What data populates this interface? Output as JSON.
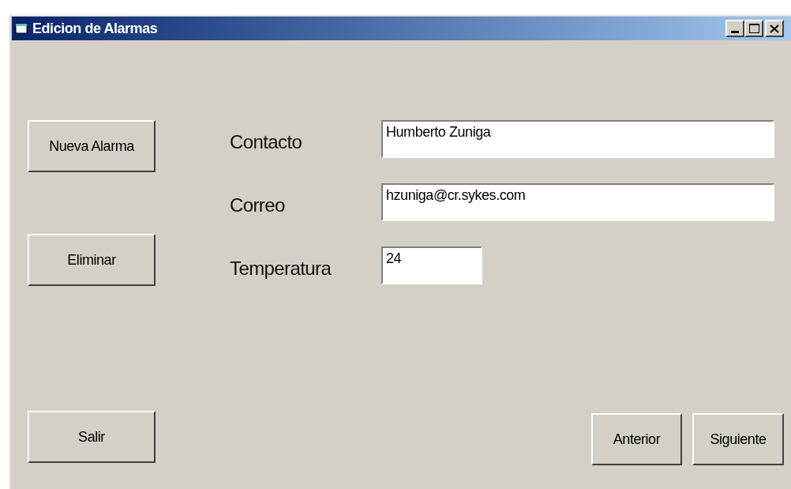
{
  "window": {
    "title": "Edicion de Alarmas"
  },
  "side_buttons": [
    "Nueva Alarma",
    "Eliminar"
  ],
  "fields": [
    {
      "label": "Contacto",
      "value": "Humberto Zuniga",
      "kind": "wide"
    },
    {
      "label": "Correo",
      "value": "hzuniga@cr.sykes.com",
      "kind": "wide"
    },
    {
      "label": "Temperatura",
      "value": "24",
      "kind": "short"
    }
  ],
  "exit_button": "Salir",
  "nav_buttons": [
    "Anterior",
    "Siguiente"
  ]
}
